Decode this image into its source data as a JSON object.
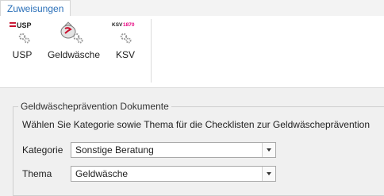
{
  "tabs": [
    {
      "label": "Zuweisungen"
    }
  ],
  "ribbon": {
    "buttons": [
      {
        "label": "USP",
        "logo_text": "USP",
        "icon": "usp-logo-with-gears-icon"
      },
      {
        "label": "Geldwäsche",
        "icon": "money-bag-with-gears-icon"
      },
      {
        "label": "KSV",
        "logo_text_a": "KSV",
        "logo_text_b": "1870",
        "icon": "ksv-logo-with-gears-icon"
      }
    ]
  },
  "group": {
    "title": "Geldwäscheprävention Dokumente",
    "description": "Wählen Sie Kategorie sowie Thema für die Checklisten zur Geldwäscheprävention",
    "fields": [
      {
        "label": "Kategorie",
        "value": "Sonstige Beratung"
      },
      {
        "label": "Thema",
        "value": "Geldwäsche"
      }
    ]
  },
  "colors": {
    "tab_text": "#2a6fb8",
    "usp_red": "#c8102e",
    "ksv_pink": "#e6007e",
    "gear_gray": "#9a9a9a"
  }
}
